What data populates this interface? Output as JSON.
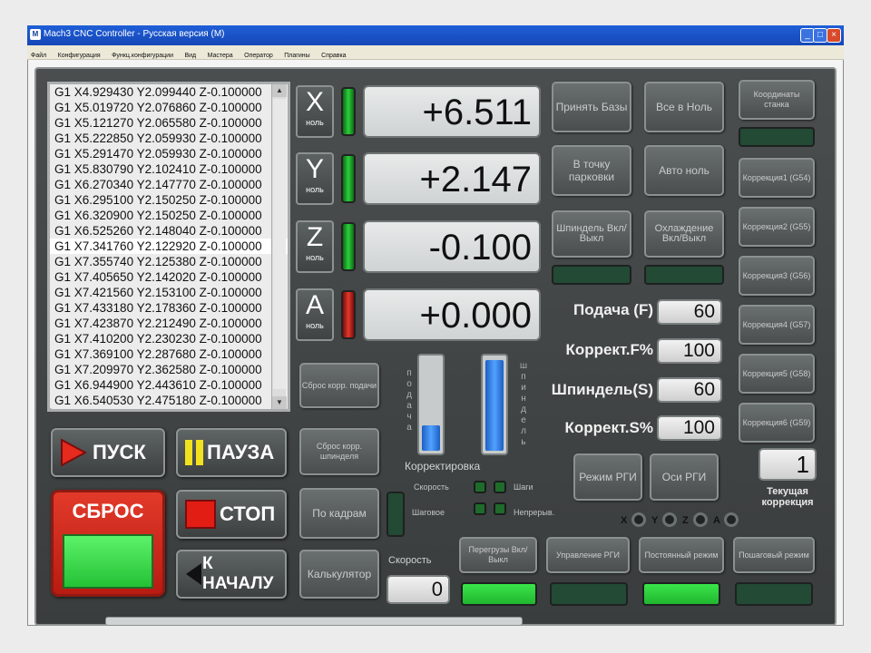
{
  "window": {
    "title": "Mach3 CNC Controller - Русская версия (M)",
    "icon_label": "M",
    "controls": [
      "_",
      "□",
      "×"
    ]
  },
  "menu": [
    "Файл",
    "Конфигурация",
    "Функц.конфигурации",
    "Вид",
    "Мастера",
    "Оператор",
    "Плагины",
    "Справка"
  ],
  "gcode": [
    "G1 X4.929430 Y2.099440 Z-0.100000",
    "G1 X5.019720 Y2.076860 Z-0.100000",
    "G1 X5.121270 Y2.065580 Z-0.100000",
    "G1 X5.222850 Y2.059930 Z-0.100000",
    "G1 X5.291470 Y2.059930 Z-0.100000",
    "G1 X5.830790 Y2.102410 Z-0.100000",
    "G1 X6.270340 Y2.147770 Z-0.100000",
    "G1 X6.295100 Y2.150250 Z-0.100000",
    "G1 X6.320900 Y2.150250 Z-0.100000",
    "G1 X6.525260 Y2.148040 Z-0.100000",
    "G1 X7.341760 Y2.122920 Z-0.100000",
    "G1 X7.355740 Y2.125380 Z-0.100000",
    "G1 X7.405650 Y2.142020 Z-0.100000",
    "G1 X7.421560 Y2.153100 Z-0.100000",
    "G1 X7.433180 Y2.178360 Z-0.100000",
    "G1 X7.423870 Y2.212490 Z-0.100000",
    "G1 X7.410200 Y2.230230 Z-0.100000",
    "G1 X7.369100 Y2.287680 Z-0.100000",
    "G1 X7.209970 Y2.362580 Z-0.100000",
    "G1 X6.944900 Y2.443610 Z-0.100000",
    "G1 X6.540530 Y2.475180 Z-0.100000"
  ],
  "gcode_selected_index": 10,
  "axes": [
    {
      "letter": "X",
      "sub": "ноль",
      "value": "+6.511",
      "led": "green"
    },
    {
      "letter": "Y",
      "sub": "ноль",
      "value": "+2.147",
      "led": "green"
    },
    {
      "letter": "Z",
      "sub": "ноль",
      "value": "-0.100",
      "led": "green"
    },
    {
      "letter": "A",
      "sub": "ноль",
      "value": "+0.000",
      "led": "red"
    }
  ],
  "buttons": {
    "accept_bases": "Принять Базы",
    "all_zero": "Все в Ноль",
    "goto_park": "В точку парковки",
    "auto_zero": "Авто ноль",
    "spindle_toggle": "Шпиндель Вкл/Выкл",
    "cooling_toggle": "Охлаждение Вкл/Выкл",
    "coords_machine": "Координаты станка",
    "corr1": "Коррекция1 (G54)",
    "corr2": "Коррекция2 (G55)",
    "corr3": "Коррекция3 (G56)",
    "corr4": "Коррекция4 (G57)",
    "corr5": "Коррекция5 (G58)",
    "corr6": "Коррекция6 (G59)",
    "reset_feed": "Сброс корр. подачи",
    "reset_spindle": "Сброс корр. шпинделя",
    "by_frames": "По кадрам",
    "calculator": "Калькулятор",
    "mode_rgi": "Режим РГИ",
    "axes_rgi": "Оси РГИ",
    "override_toggle": "Перегрузы Вкл/Выкл",
    "control_rgi": "Управление РГИ",
    "const_mode": "Постоянный режим",
    "step_mode": "Пошаговый режим",
    "start": "ПУСК",
    "pause": "ПАУЗА",
    "reset": "СБРОС",
    "stop": "СТОП",
    "to_start": "К НАЧАЛУ"
  },
  "fields": {
    "feed_label": "Подача (F)",
    "feed_value": "60",
    "feed_corr_label": "Коррект.F%",
    "feed_corr_value": "100",
    "spindle_label": "Шпиндель(S)",
    "spindle_value": "60",
    "spindle_corr_label": "Коррект.S%",
    "spindle_corr_value": "100",
    "current_corr_value": "1",
    "current_corr_label": "Текущая коррекция",
    "speed_label": "Скорость",
    "speed_value": "0"
  },
  "bars": {
    "feed_label": "подача",
    "spindle_label": "шпиндель",
    "feed_fill": 0.5,
    "spindle_fill": 1.0,
    "caption": "Корректировка"
  },
  "jog": {
    "speed": "Скорость",
    "step": "Шаги",
    "stepwise": "Шаговое",
    "continuous": "Непрерыв."
  },
  "axis_select": [
    "X",
    "Y",
    "Z",
    "A"
  ],
  "colors": {
    "panel": "#404444",
    "led_green": "#2bcf3b",
    "led_red": "#e23a2a",
    "reset_red": "#d6261a",
    "bar_blue": "#3a8af0"
  }
}
